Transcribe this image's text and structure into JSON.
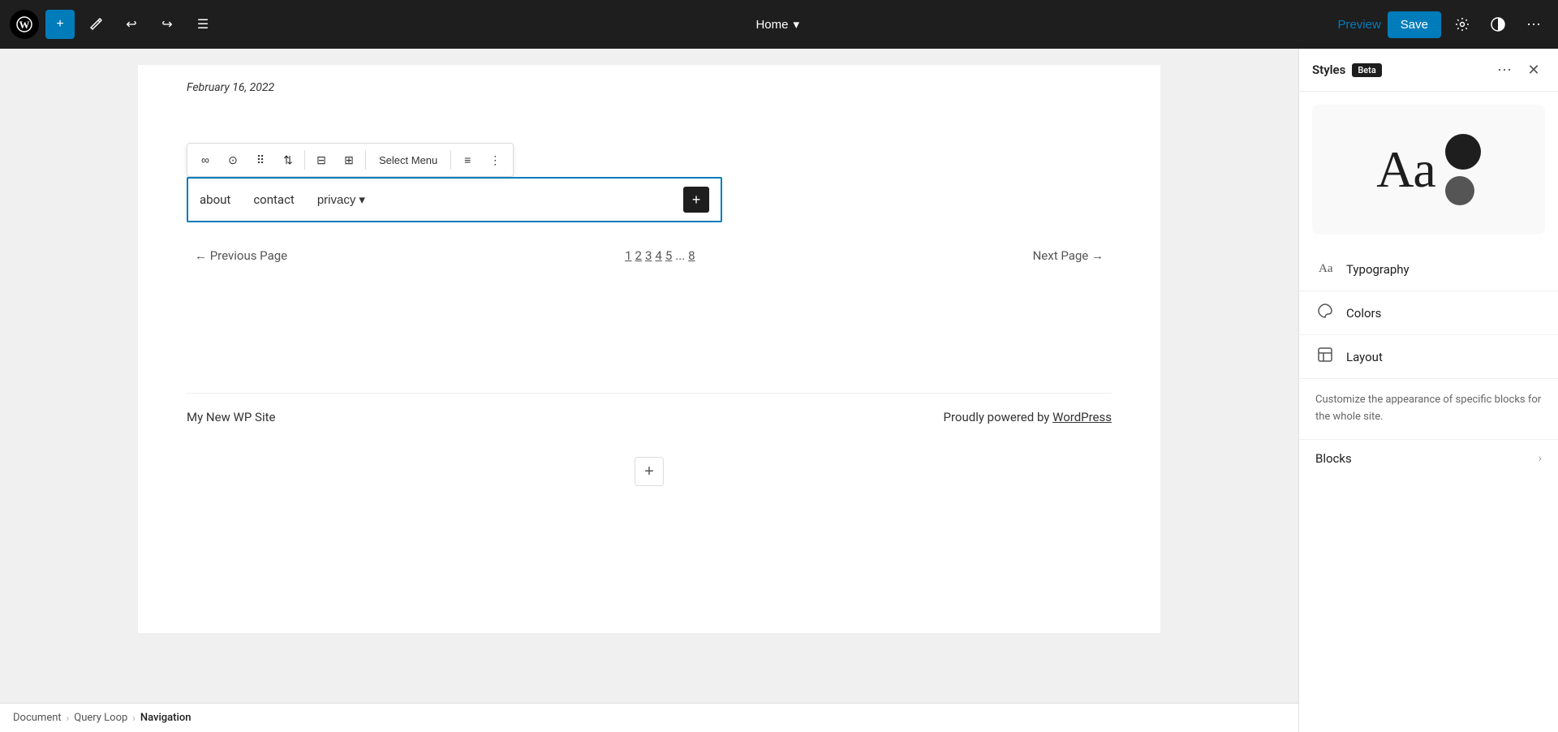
{
  "toolbar": {
    "add_label": "+",
    "undo_label": "↩",
    "redo_label": "↪",
    "list_view_label": "☰",
    "home_label": "Home",
    "preview_label": "Preview",
    "save_label": "Save",
    "settings_label": "⚙",
    "style_label": "◑",
    "more_label": "⋯"
  },
  "canvas": {
    "date": "February 16, 2022",
    "nav_items": [
      "about",
      "contact",
      "privacy"
    ],
    "privacy_has_dropdown": true,
    "pagination": {
      "prev_label": "← Previous Page",
      "next_label": "Next Page →",
      "pages": [
        "1",
        "2",
        "3",
        "4",
        "5",
        "...",
        "8"
      ]
    },
    "footer": {
      "site_name": "My New WP Site",
      "powered_by_prefix": "Proudly powered by ",
      "powered_by_link": "WordPress"
    }
  },
  "block_toolbar": {
    "link_icon": "∞",
    "info_icon": "⊙",
    "drag_icon": "⠿",
    "arrows_icon": "⇅",
    "align_left_icon": "⊟",
    "align_center_icon": "⊞",
    "select_menu_label": "Select Menu",
    "align_icon": "≡",
    "more_icon": "⋮"
  },
  "right_panel": {
    "styles_title": "Styles",
    "beta_label": "Beta",
    "more_icon": "⋯",
    "close_icon": "✕",
    "preview_text": "Aa",
    "typography_label": "Typography",
    "colors_label": "Colors",
    "layout_label": "Layout",
    "description": "Customize the appearance of specific blocks for the whole site.",
    "blocks_label": "Blocks",
    "blocks_arrow": "›"
  },
  "breadcrumb": {
    "document": "Document",
    "query_loop": "Query Loop",
    "navigation": "Navigation",
    "sep": "›"
  }
}
